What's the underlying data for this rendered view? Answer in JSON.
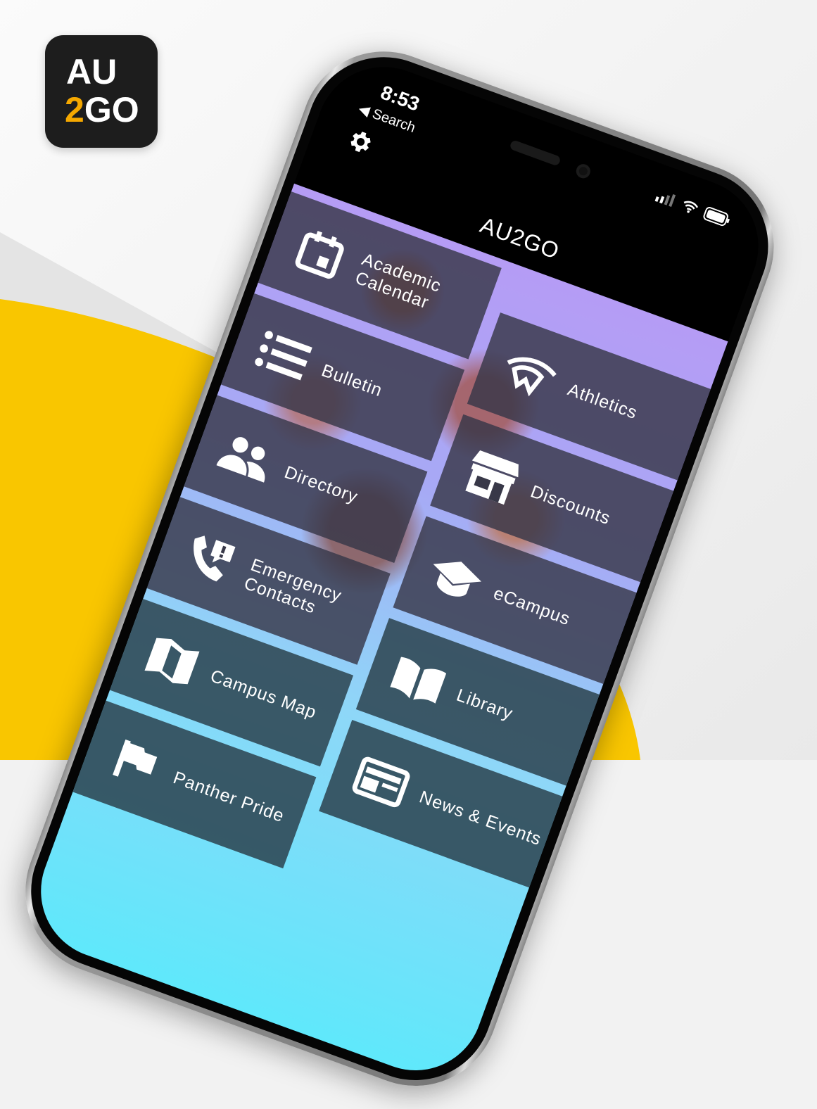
{
  "logo": {
    "line1": "AU",
    "two": "2",
    "go": "GO"
  },
  "status_bar": {
    "time": "8:53",
    "back_label": "Search"
  },
  "header": {
    "title": "AU2GO",
    "settings_icon": "gear-icon"
  },
  "colors": {
    "accent_yellow": "#f9c600",
    "logo_orange": "#f5a800",
    "gradient_top": "#b59cf5",
    "gradient_bottom": "#5fe8fb"
  },
  "tiles_left": [
    {
      "label": "Academic Calendar",
      "icon": "calendar-icon"
    },
    {
      "label": "Bulletin",
      "icon": "list-icon"
    },
    {
      "label": "Directory",
      "icon": "people-icon"
    },
    {
      "label": "Emergency Contacts",
      "icon": "emergency-phone-icon"
    },
    {
      "label": "Campus Map",
      "icon": "map-icon"
    },
    {
      "label": "Panther Pride",
      "icon": "flag-icon"
    }
  ],
  "tiles_right": [
    {
      "label": "Athletics",
      "icon": "panther-icon"
    },
    {
      "label": "Discounts",
      "icon": "store-icon"
    },
    {
      "label": "eCampus",
      "icon": "graduation-cap-icon"
    },
    {
      "label": "Library",
      "icon": "book-icon"
    },
    {
      "label": "News & Events",
      "icon": "news-icon"
    }
  ]
}
